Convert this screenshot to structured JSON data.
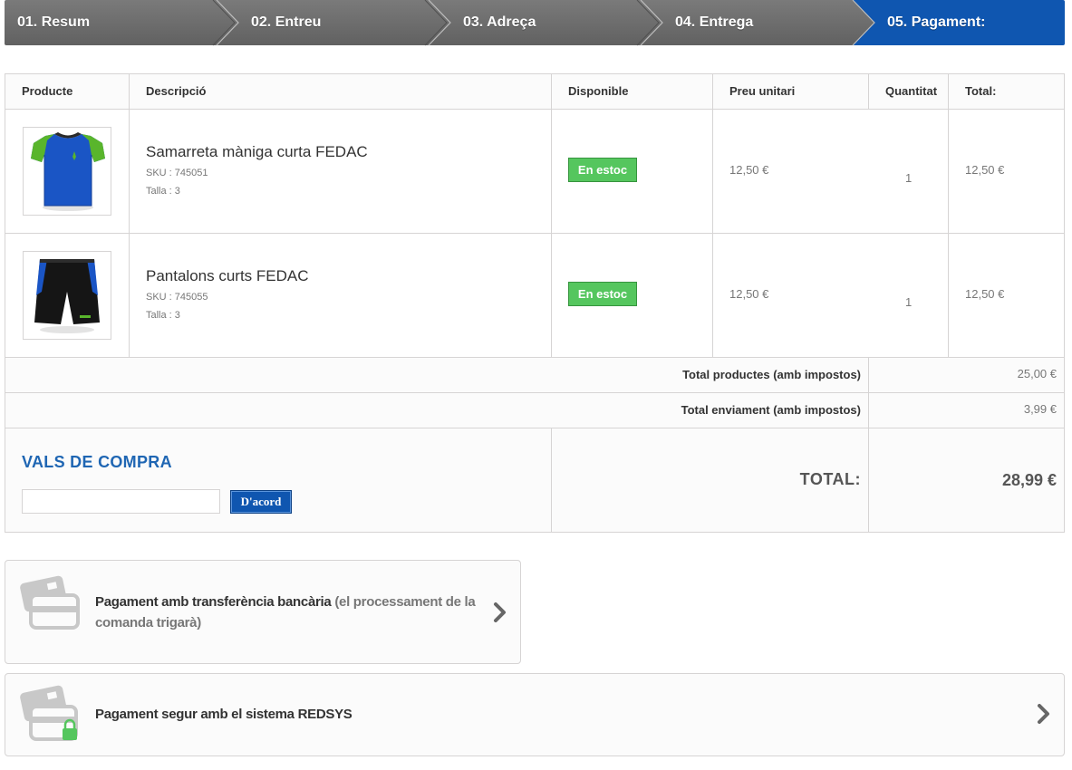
{
  "steps": [
    {
      "label": "01. Resum"
    },
    {
      "label": "02. Entreu"
    },
    {
      "label": "03. Adreça"
    },
    {
      "label": "04. Entrega"
    },
    {
      "label": "05. Pagament:"
    }
  ],
  "colors": {
    "step_inactive": "#707070",
    "step_active": "#0f56b0",
    "stock_badge": "#55c65e",
    "accent": "#1f66b3"
  },
  "cart": {
    "headers": [
      "Producte",
      "Descripció",
      "Disponible",
      "Preu unitari",
      "Quantitat",
      "Total:"
    ],
    "rows": [
      {
        "image": "tshirt-image",
        "name": "Samarreta màniga curta FEDAC",
        "sku": "SKU : 745051",
        "size": "Talla : 3",
        "availability": "En estoc",
        "unit_price": "12,50 €",
        "quantity": "1",
        "total": "12,50 €"
      },
      {
        "image": "shorts-image",
        "name": "Pantalons curts FEDAC",
        "sku": "SKU : 745055",
        "size": "Talla : 3",
        "availability": "En estoc",
        "unit_price": "12,50 €",
        "quantity": "1",
        "total": "12,50 €"
      }
    ],
    "total_products_label": "Total productes (amb impostos)",
    "total_products_value": "25,00 €",
    "total_shipping_label": "Total enviament (amb impostos)",
    "total_shipping_value": "3,99 €",
    "total_label": "TOTAL:",
    "total_value": "28,99 €"
  },
  "voucher": {
    "title": "VALS DE COMPRA",
    "input_value": "",
    "button_label": "D'acord"
  },
  "payment": [
    {
      "icon": "credit-card-icon",
      "title": "Pagament amb transferència bancària",
      "note": "(el processament de la comanda trigarà)"
    },
    {
      "icon": "secure-card-icon",
      "title": "Pagament segur amb el sistema REDSYS",
      "note": ""
    }
  ]
}
